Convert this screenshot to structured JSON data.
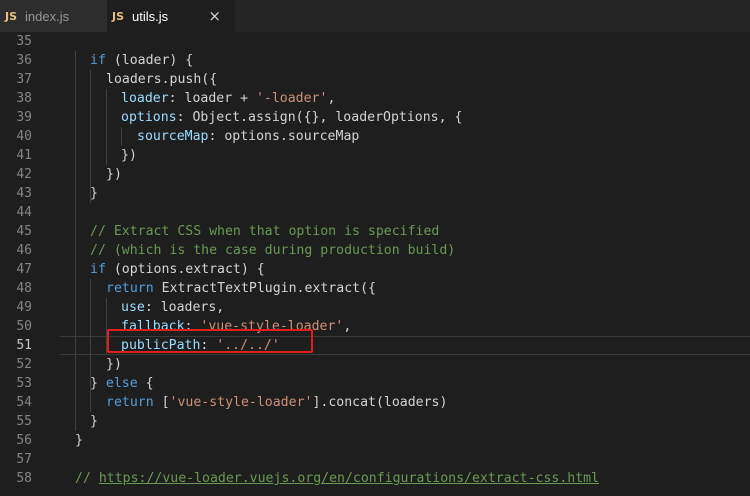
{
  "tabs": [
    {
      "icon": "JS",
      "label": "index.js"
    },
    {
      "icon": "JS",
      "label": "utils.js",
      "close": "×"
    }
  ],
  "lines": [
    {
      "n": "35",
      "tokens": []
    },
    {
      "n": "36",
      "tokens": [
        {
          "t": "kw",
          "v": "if"
        },
        {
          "t": "p",
          "v": " (loader) {"
        }
      ]
    },
    {
      "n": "37",
      "tokens": [
        {
          "t": "p",
          "v": "loaders.push({"
        }
      ]
    },
    {
      "n": "38",
      "tokens": [
        {
          "t": "prop",
          "v": "loader"
        },
        {
          "t": "p",
          "v": ": loader + "
        },
        {
          "t": "str",
          "v": "'-loader'"
        },
        {
          "t": "p",
          "v": ","
        }
      ]
    },
    {
      "n": "39",
      "tokens": [
        {
          "t": "prop",
          "v": "options"
        },
        {
          "t": "p",
          "v": ": Object.assign({}, loaderOptions, {"
        }
      ]
    },
    {
      "n": "40",
      "tokens": [
        {
          "t": "prop",
          "v": "sourceMap"
        },
        {
          "t": "p",
          "v": ": options.sourceMap"
        }
      ]
    },
    {
      "n": "41",
      "tokens": [
        {
          "t": "p",
          "v": "})"
        }
      ]
    },
    {
      "n": "42",
      "tokens": [
        {
          "t": "p",
          "v": "})"
        }
      ]
    },
    {
      "n": "43",
      "tokens": [
        {
          "t": "p",
          "v": "}"
        }
      ]
    },
    {
      "n": "44",
      "tokens": []
    },
    {
      "n": "45",
      "tokens": [
        {
          "t": "cm",
          "v": "// Extract CSS when that option is specified"
        }
      ]
    },
    {
      "n": "46",
      "tokens": [
        {
          "t": "cm",
          "v": "// (which is the case during production build)"
        }
      ]
    },
    {
      "n": "47",
      "tokens": [
        {
          "t": "kw",
          "v": "if"
        },
        {
          "t": "p",
          "v": " (options.extract) {"
        }
      ]
    },
    {
      "n": "48",
      "tokens": [
        {
          "t": "kw",
          "v": "return"
        },
        {
          "t": "p",
          "v": " ExtractTextPlugin.extract({"
        }
      ]
    },
    {
      "n": "49",
      "tokens": [
        {
          "t": "prop",
          "v": "use"
        },
        {
          "t": "p",
          "v": ": loaders,"
        }
      ]
    },
    {
      "n": "50",
      "tokens": [
        {
          "t": "prop",
          "v": "fallback"
        },
        {
          "t": "p",
          "v": ": "
        },
        {
          "t": "str",
          "v": "'vue-style-loader'"
        },
        {
          "t": "p",
          "v": ","
        }
      ]
    },
    {
      "n": "51",
      "tokens": [
        {
          "t": "prop",
          "v": "publicPath"
        },
        {
          "t": "p",
          "v": ": "
        },
        {
          "t": "str",
          "v": "'../../'"
        }
      ]
    },
    {
      "n": "52",
      "tokens": [
        {
          "t": "p",
          "v": "})"
        }
      ]
    },
    {
      "n": "53",
      "tokens": [
        {
          "t": "p",
          "v": "} "
        },
        {
          "t": "kw",
          "v": "else"
        },
        {
          "t": "p",
          "v": " {"
        }
      ]
    },
    {
      "n": "54",
      "tokens": [
        {
          "t": "kw",
          "v": "return"
        },
        {
          "t": "p",
          "v": " ["
        },
        {
          "t": "str",
          "v": "'vue-style-loader'"
        },
        {
          "t": "p",
          "v": "].concat(loaders)"
        }
      ]
    },
    {
      "n": "55",
      "tokens": [
        {
          "t": "p",
          "v": "}"
        }
      ]
    },
    {
      "n": "56",
      "tokens": [
        {
          "t": "p",
          "v": "}"
        }
      ]
    },
    {
      "n": "57",
      "tokens": []
    },
    {
      "n": "58",
      "tokens": [
        {
          "t": "cm",
          "v": "// "
        },
        {
          "t": "link",
          "v": "https://vue-loader.vuejs.org/en/configurations/extract-css.html"
        }
      ]
    }
  ],
  "current_line": "51",
  "colors": {
    "keyword": "#569cd6",
    "string": "#ce9178",
    "property": "#9cdcfe",
    "comment": "#6a9955",
    "highlight_box": "#e11d1d"
  }
}
